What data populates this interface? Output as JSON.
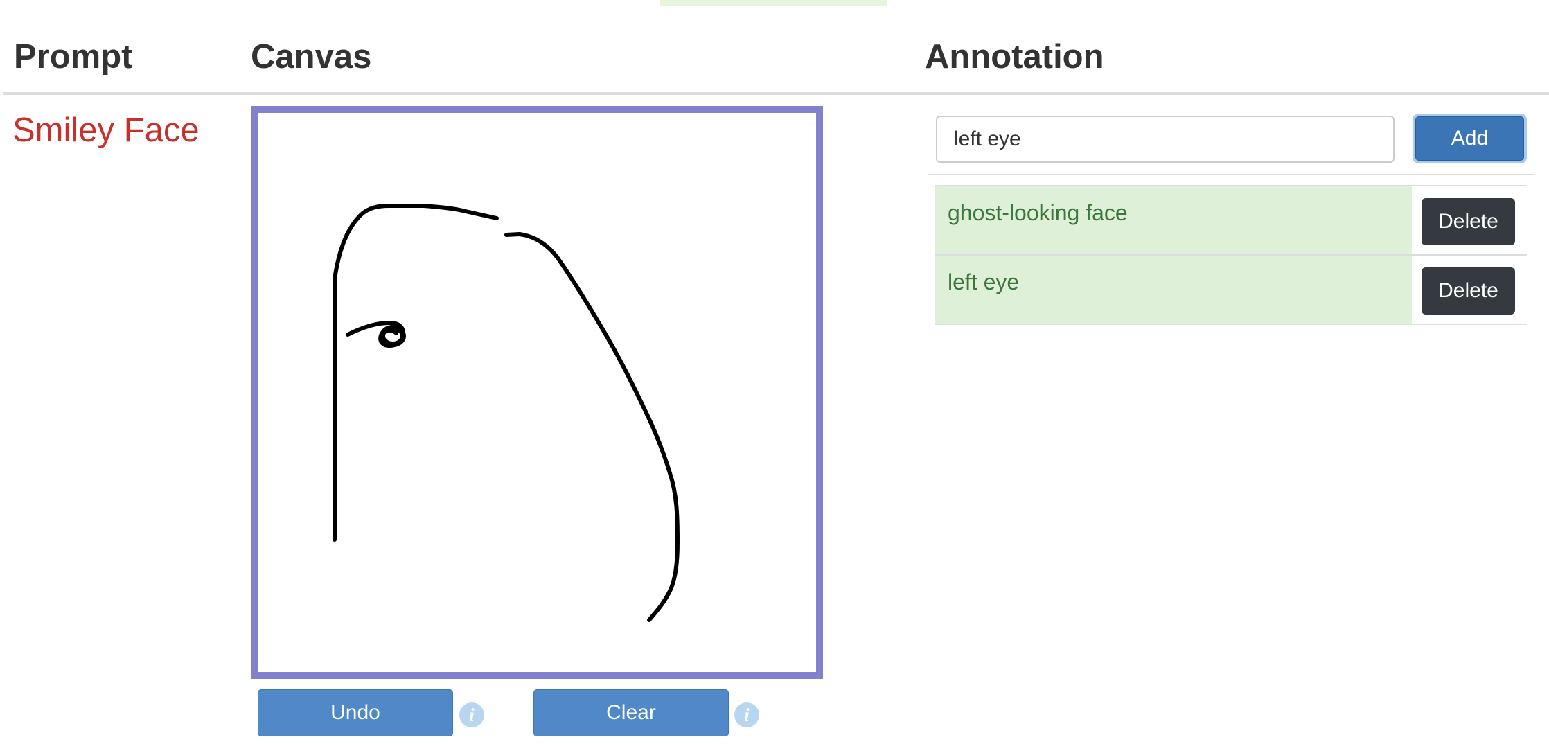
{
  "header": {
    "prompt_title": "Prompt",
    "canvas_title": "Canvas",
    "annotation_title": "Annotation"
  },
  "prompt": {
    "text": "Smiley Face"
  },
  "canvas": {
    "stroke_color": "#000000",
    "border_color": "#8181cd",
    "undo_label": "Undo",
    "clear_label": "Clear",
    "info_glyph": "i"
  },
  "annotation": {
    "input_value": "left eye",
    "add_label": "Add",
    "items": [
      {
        "label": "ghost-looking face",
        "delete_label": "Delete"
      },
      {
        "label": "left eye",
        "delete_label": "Delete"
      }
    ]
  },
  "colors": {
    "prompt_text": "#c9302c",
    "primary_button": "#5088c8",
    "annotation_bg": "#dff0d8",
    "annotation_text": "#3c763d",
    "delete_button": "#343a40"
  }
}
